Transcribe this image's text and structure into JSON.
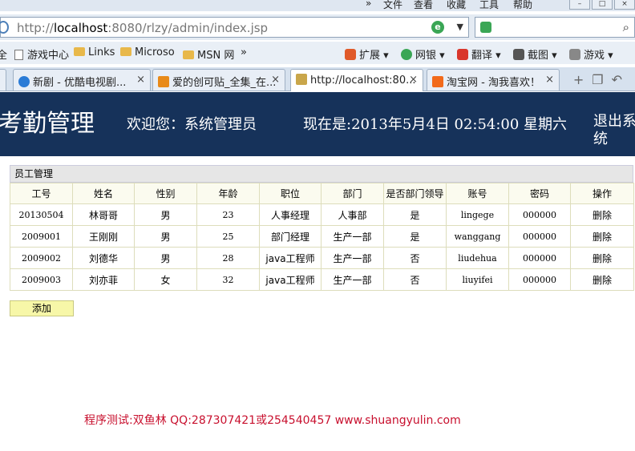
{
  "browser": {
    "menu": [
      "文件",
      "查看",
      "收藏",
      "工具",
      "帮助"
    ],
    "url_host": "localhost",
    "url_prefix": "http://",
    "url_rest": ":8080/rlzy/admin/index.jsp",
    "favorites": [
      "全",
      "游戏中心",
      "Links",
      "Microso",
      "MSN 网"
    ],
    "toolbar": [
      "扩展",
      "网银",
      "翻译",
      "截图",
      "游戏"
    ],
    "tabs": [
      {
        "label": "新剧 - 优酷电视剧..."
      },
      {
        "label": "爱的创可贴_全集_在..."
      },
      {
        "label": "http://localhost:80..."
      },
      {
        "label": "淘宝网 - 淘我喜欢！"
      }
    ]
  },
  "header": {
    "system_title": "考勤管理",
    "welcome": "欢迎您：系统管理员",
    "now": "现在是:2013年5月4日  02:54:00 星期六",
    "logout": "退出系统"
  },
  "panel": {
    "title": "员工管理",
    "columns": [
      "工号",
      "姓名",
      "性别",
      "年龄",
      "职位",
      "部门",
      "是否部门领导",
      "账号",
      "密码",
      "操作"
    ],
    "rows": [
      [
        "20130504",
        "林哥哥",
        "男",
        "23",
        "人事经理",
        "人事部",
        "是",
        "lingege",
        "000000",
        "删除"
      ],
      [
        "2009001",
        "王刚刚",
        "男",
        "25",
        "部门经理",
        "生产一部",
        "是",
        "wanggang",
        "000000",
        "删除"
      ],
      [
        "2009002",
        "刘德华",
        "男",
        "28",
        "java工程师",
        "生产一部",
        "否",
        "liudehua",
        "000000",
        "删除"
      ],
      [
        "2009003",
        "刘亦菲",
        "女",
        "32",
        "java工程师",
        "生产一部",
        "否",
        "liuyifei",
        "000000",
        "删除"
      ]
    ],
    "add_label": "添加"
  },
  "footer": "程序测试:双鱼林 QQ:287307421或254540457 www.shuangyulin.com"
}
